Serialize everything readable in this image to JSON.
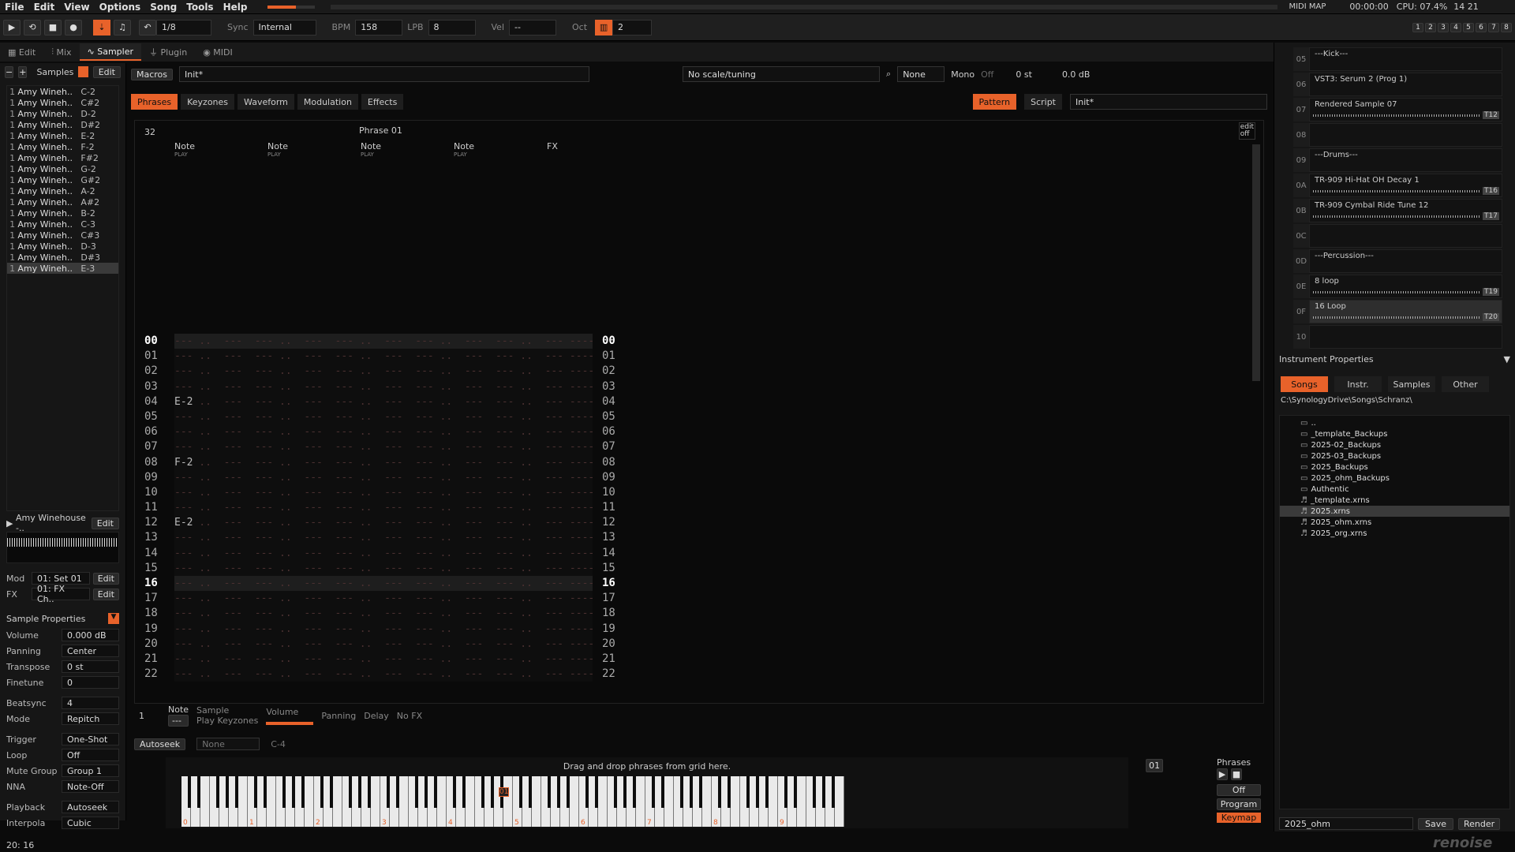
{
  "menu": [
    "File",
    "Edit",
    "View",
    "Options",
    "Song",
    "Tools",
    "Help"
  ],
  "status": {
    "midi_map": "MIDI MAP",
    "time": "00:00:00",
    "cpu": "CPU: 07.4%",
    "right_nums": "14  21"
  },
  "transport": {
    "pattern_step": "1/8",
    "sync_label": "Sync",
    "sync_value": "Internal",
    "bpm_label": "BPM",
    "bpm": "158",
    "lpb_label": "LPB",
    "lpb": "8",
    "vel_label": "Vel",
    "vel": "--",
    "oct_label": "Oct",
    "oct": "2"
  },
  "track_nums": [
    "1",
    "2",
    "3",
    "4",
    "5",
    "6",
    "7",
    "8"
  ],
  "main_tabs": [
    {
      "label": "Edit"
    },
    {
      "label": "Mix"
    },
    {
      "label": "Sampler"
    },
    {
      "label": "Plugin"
    },
    {
      "label": "MIDI"
    }
  ],
  "samples_header": {
    "title": "Samples",
    "edit": "Edit"
  },
  "samples": [
    {
      "n": "1",
      "name": "Amy Wineh..",
      "key": "C-2"
    },
    {
      "n": "1",
      "name": "Amy Wineh..",
      "key": "C#2"
    },
    {
      "n": "1",
      "name": "Amy Wineh..",
      "key": "D-2"
    },
    {
      "n": "1",
      "name": "Amy Wineh..",
      "key": "D#2"
    },
    {
      "n": "1",
      "name": "Amy Wineh..",
      "key": "E-2"
    },
    {
      "n": "1",
      "name": "Amy Wineh..",
      "key": "F-2"
    },
    {
      "n": "1",
      "name": "Amy Wineh..",
      "key": "F#2"
    },
    {
      "n": "1",
      "name": "Amy Wineh..",
      "key": "G-2"
    },
    {
      "n": "1",
      "name": "Amy Wineh..",
      "key": "G#2"
    },
    {
      "n": "1",
      "name": "Amy Wineh..",
      "key": "A-2"
    },
    {
      "n": "1",
      "name": "Amy Wineh..",
      "key": "A#2"
    },
    {
      "n": "1",
      "name": "Amy Wineh..",
      "key": "B-2"
    },
    {
      "n": "1",
      "name": "Amy Wineh..",
      "key": "C-3"
    },
    {
      "n": "1",
      "name": "Amy Wineh..",
      "key": "C#3"
    },
    {
      "n": "1",
      "name": "Amy Wineh..",
      "key": "D-3"
    },
    {
      "n": "1",
      "name": "Amy Wineh..",
      "key": "D#3"
    },
    {
      "n": "1",
      "name": "Amy Wineh..",
      "key": "E-3"
    }
  ],
  "sample_preview": {
    "name": "Amy Winehouse -..",
    "edit": "Edit"
  },
  "mod": {
    "label": "Mod",
    "value": "01: Set 01",
    "edit": "Edit"
  },
  "fx": {
    "label": "FX",
    "value": "01: FX Ch..",
    "edit": "Edit"
  },
  "sample_props": {
    "title": "Sample Properties",
    "rows": [
      {
        "label": "Volume",
        "value": "0.000 dB"
      },
      {
        "label": "Panning",
        "value": "Center"
      },
      {
        "label": "Transpose",
        "value": "0 st"
      },
      {
        "label": "Finetune",
        "value": "0"
      },
      {
        "label": "Beatsync",
        "value": "4"
      },
      {
        "label": "Mode",
        "value": "Repitch"
      },
      {
        "label": "Trigger",
        "value": "One-Shot"
      },
      {
        "label": "Loop",
        "value": "Off"
      },
      {
        "label": "Mute Group",
        "value": "Group 1"
      },
      {
        "label": "NNA",
        "value": "Note-Off"
      },
      {
        "label": "Playback",
        "value": "Autoseek"
      },
      {
        "label": "Interpola",
        "value": "Cubic"
      }
    ]
  },
  "bottom_left": {
    "value": "20: 16"
  },
  "macros": {
    "label": "Macros",
    "preset": "Init*",
    "tuning": "No scale/tuning",
    "none": "None",
    "mono": "Mono",
    "off": "Off",
    "st": "0 st",
    "db": "0.0 dB"
  },
  "sub_tabs": [
    {
      "label": "Phrases"
    },
    {
      "label": "Keyzones"
    },
    {
      "label": "Waveform"
    },
    {
      "label": "Modulation"
    },
    {
      "label": "Effects"
    }
  ],
  "pattern_tabs": {
    "pattern": "Pattern",
    "script": "Script",
    "preset": "Init*"
  },
  "phrase": {
    "lines": "32",
    "title": "Phrase 01",
    "edit_off": "edit\noff",
    "cols": [
      "Note",
      "Note",
      "Note",
      "Note",
      "FX"
    ],
    "sub": "PLAY"
  },
  "line_numbers": [
    "00",
    "01",
    "02",
    "03",
    "04",
    "05",
    "06",
    "07",
    "08",
    "09",
    "10",
    "11",
    "12",
    "13",
    "14",
    "15",
    "16",
    "17",
    "18",
    "19",
    "20",
    "21",
    "22"
  ],
  "notes": {
    "4": "E-2",
    "8": "F-2",
    "12": "E-2"
  },
  "phrase_footer": {
    "num": "1",
    "note": "Note",
    "dash": "---",
    "sample": "Sample",
    "play_keyzones": "Play Keyzones",
    "volume": "Volume",
    "panning": "Panning",
    "delay": "Delay",
    "nofx": "No FX"
  },
  "autoseek": {
    "label": "Autoseek",
    "none": "None",
    "key": "C-4"
  },
  "keyboard": {
    "hint": "Drag and drop phrases from grid here.",
    "octaves": [
      "0",
      "1",
      "2",
      "3",
      "4",
      "5",
      "6",
      "7",
      "8",
      "9"
    ],
    "marker": "01"
  },
  "phrases_panel": {
    "title": "Phrases",
    "num": "01",
    "off": "Off",
    "program": "Program",
    "keymap": "Keymap"
  },
  "instruments": [
    {
      "num": "05",
      "name": "---Kick---"
    },
    {
      "num": "06",
      "name": "VST3: Serum 2 (Prog 1)"
    },
    {
      "num": "07",
      "name": "Rendered Sample 07",
      "tag": "T12"
    },
    {
      "num": "08",
      "name": ""
    },
    {
      "num": "09",
      "name": "---Drums---"
    },
    {
      "num": "0A",
      "name": "TR-909 Hi-Hat OH Decay 1",
      "tag": "T16"
    },
    {
      "num": "0B",
      "name": "TR-909 Cymbal Ride Tune 12",
      "tag": "T17"
    },
    {
      "num": "0C",
      "name": ""
    },
    {
      "num": "0D",
      "name": "---Percussion---"
    },
    {
      "num": "0E",
      "name": "8 loop",
      "tag": "T19"
    },
    {
      "num": "0F",
      "name": "16 Loop",
      "tag": "T20"
    },
    {
      "num": "10",
      "name": ""
    }
  ],
  "inst_props": "Instrument Properties",
  "browser_tabs": [
    {
      "label": "Songs"
    },
    {
      "label": "Instr."
    },
    {
      "label": "Samples"
    },
    {
      "label": "Other"
    }
  ],
  "browser_path": "C:\\SynologyDrive\\Songs\\Schranz\\",
  "files": [
    "..",
    "_template_Backups",
    "2025-02_Backups",
    "2025-03_Backups",
    "2025_Backups",
    "2025_ohm_Backups",
    "Authentic",
    "_template.xrns",
    "2025.xrns",
    "2025_ohm.xrns",
    "2025_org.xrns"
  ],
  "save_bar": {
    "name": "2025_ohm",
    "save": "Save",
    "render": "Render"
  },
  "logo": "renoise",
  "colors": {
    "accent": "#e8622a"
  }
}
